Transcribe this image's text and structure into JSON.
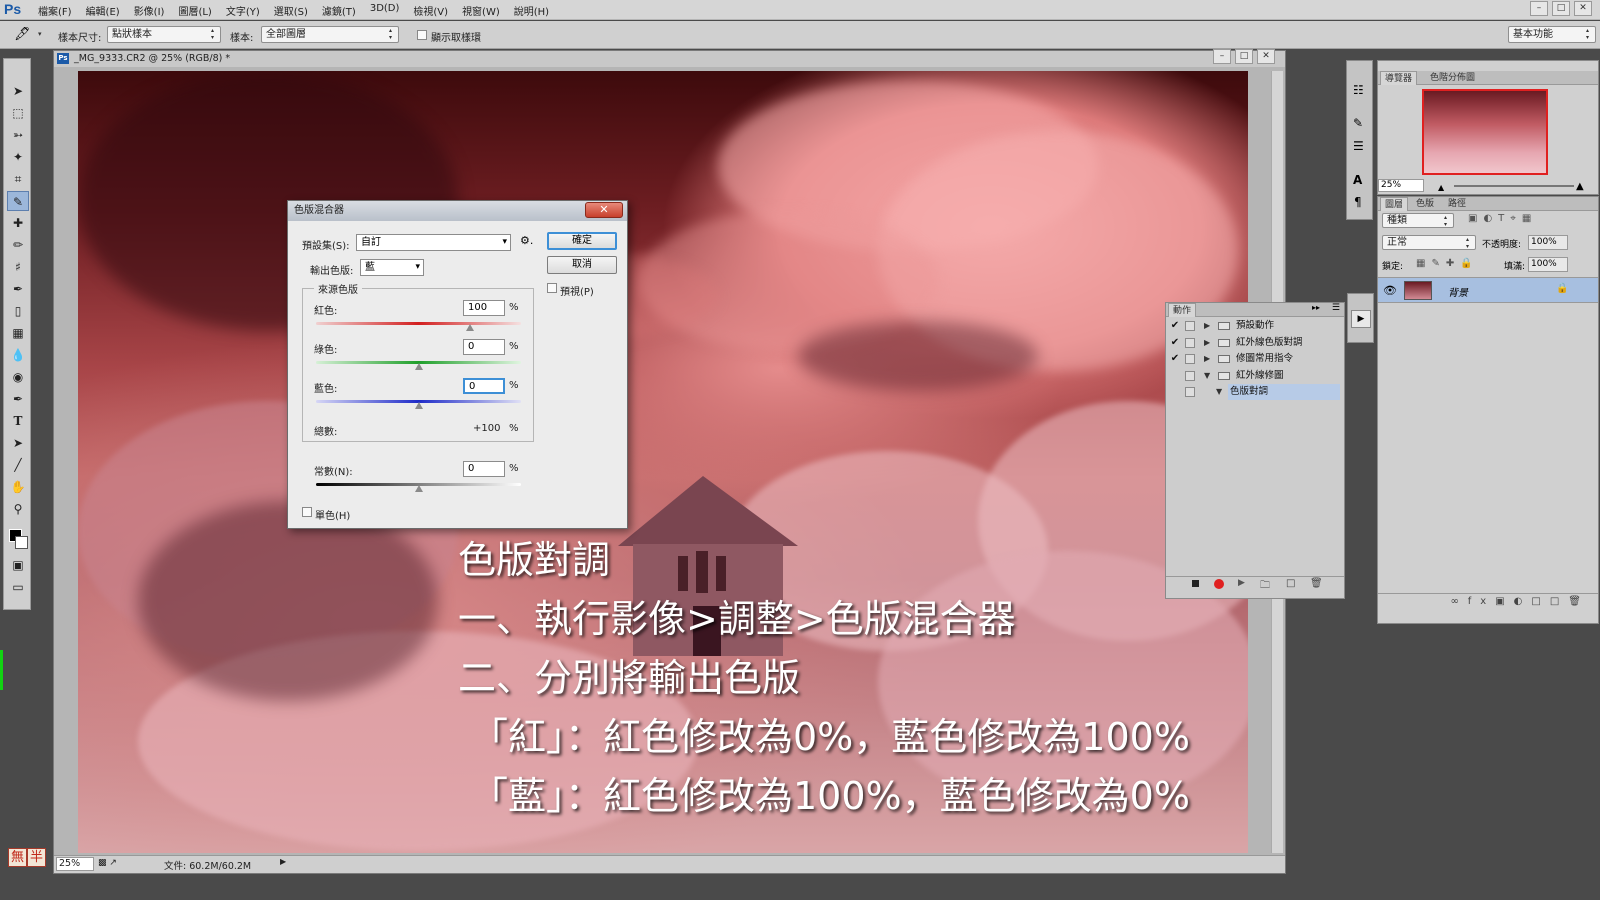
{
  "app": {
    "logo": "Ps",
    "menus": [
      "檔案(F)",
      "編輯(E)",
      "影像(I)",
      "圖層(L)",
      "文字(Y)",
      "選取(S)",
      "濾鏡(T)",
      "3D(D)",
      "檢視(V)",
      "視窗(W)",
      "說明(H)"
    ],
    "window_buttons": [
      "–",
      "□",
      "✕"
    ]
  },
  "options_bar": {
    "sample_size_label": "樣本尺寸:",
    "sample_size_value": "點狀樣本",
    "sample_label": "樣本:",
    "sample_value": "全部圖層",
    "show_ring_label": "顯示取樣環",
    "workspace_value": "基本功能"
  },
  "document": {
    "tab_title": "_MG_9333.CR2 @ 25% (RGB/8) *",
    "zoom": "25%",
    "file_info": "文件: 60.2M/60.2M",
    "overlay_lines": [
      "色版對調",
      "一、執行影像>調整>色版混合器",
      "二、分別將輸出色版",
      "「紅」：紅色修改為0%，藍色修改為100%",
      "「藍」：紅色修改為100%，藍色修改為0%"
    ]
  },
  "channel_mixer": {
    "title": "色版混合器",
    "close": "✕",
    "preset_label": "預設集(S):",
    "preset_value": "自訂",
    "output_label": "輸出色版:",
    "output_value": "藍",
    "source_group": "來源色版",
    "red_label": "紅色:",
    "red_value": "100",
    "green_label": "綠色:",
    "green_value": "0",
    "blue_label": "藍色:",
    "blue_value": "0",
    "total_label": "總數:",
    "total_value": "+100",
    "constant_label": "常數(N):",
    "constant_value": "0",
    "percent": "%",
    "monochrome_label": "單色(H)",
    "ok_label": "確定",
    "cancel_label": "取消",
    "preview_label": "預視(P)",
    "sliders": {
      "red": 100,
      "green": 0,
      "blue": 0,
      "constant": 0
    }
  },
  "navigator": {
    "tabs": [
      "導覽器",
      "色階分佈圖"
    ],
    "zoom": "25%"
  },
  "layers": {
    "tabs": [
      "圖層",
      "色版",
      "路徑"
    ],
    "filter_label": "種類",
    "blend_mode": "正常",
    "opacity_label": "不透明度:",
    "opacity_value": "100%",
    "lock_label": "鎖定:",
    "fill_label": "填滿:",
    "fill_value": "100%",
    "layer_name": "背景"
  },
  "actions": {
    "tab": "動作",
    "items": [
      {
        "name": "預設動作",
        "checked": "✔",
        "expanded": false,
        "indent": 0
      },
      {
        "name": "紅外線色版對調",
        "checked": "✔",
        "expanded": false,
        "indent": 0
      },
      {
        "name": "修圖常用指令",
        "checked": "✔",
        "expanded": false,
        "indent": 0
      },
      {
        "name": "紅外線修圖",
        "checked": "",
        "expanded": true,
        "indent": 0
      },
      {
        "name": "色版對調",
        "checked": "",
        "expanded": true,
        "indent": 1
      }
    ]
  },
  "ime": {
    "left": "無",
    "right": "半"
  },
  "colors": {
    "accent": "#3d8fd6",
    "record": "#e02020",
    "selected_row": "#b7cbe7"
  }
}
